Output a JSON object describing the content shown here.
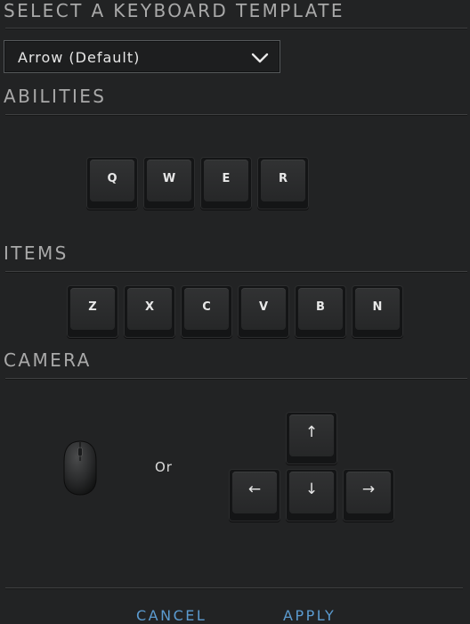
{
  "header": {
    "title": "SELECT A KEYBOARD TEMPLATE"
  },
  "template_select": {
    "value": "Arrow (Default)",
    "icon": "chevron-down-icon"
  },
  "abilities": {
    "title": "ABILITIES",
    "keys": [
      "Q",
      "W",
      "E",
      "R"
    ]
  },
  "items": {
    "title": "ITEMS",
    "keys": [
      "Z",
      "X",
      "C",
      "V",
      "B",
      "N"
    ]
  },
  "camera": {
    "title": "CAMERA",
    "mouse_icon": "mouse-icon",
    "or_label": "Or",
    "arrow_keys": {
      "up": "↑",
      "left": "←",
      "down": "↓",
      "right": "→"
    }
  },
  "footer": {
    "cancel_label": "CANCEL",
    "apply_label": "APPLY"
  },
  "colors": {
    "accent": "#5b9bd0",
    "background": "#222324",
    "key_face": "#2c2d2e"
  }
}
